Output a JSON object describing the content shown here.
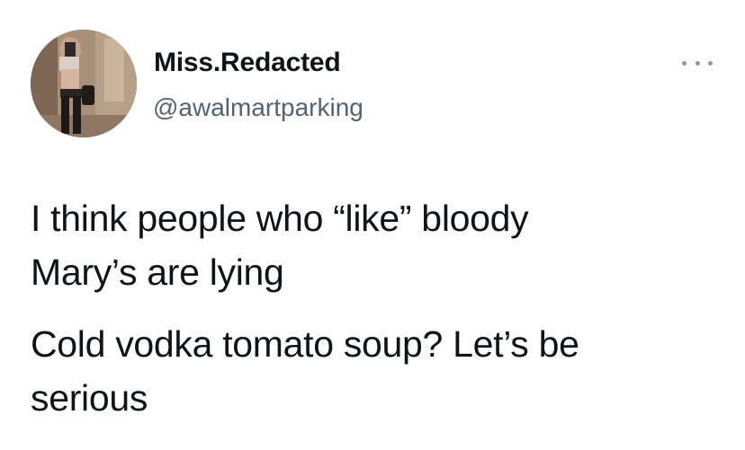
{
  "tweet": {
    "author": {
      "display_name": "Miss.Redacted",
      "handle": "@awalmartparking"
    },
    "more_icon": "more-horizontal-icon",
    "paragraphs": [
      {
        "lines": [
          "I think people who “like” bloody",
          "Mary’s are lying"
        ]
      },
      {
        "lines": [
          "Cold vodka tomato soup? Let’s be",
          "serious"
        ]
      }
    ]
  }
}
